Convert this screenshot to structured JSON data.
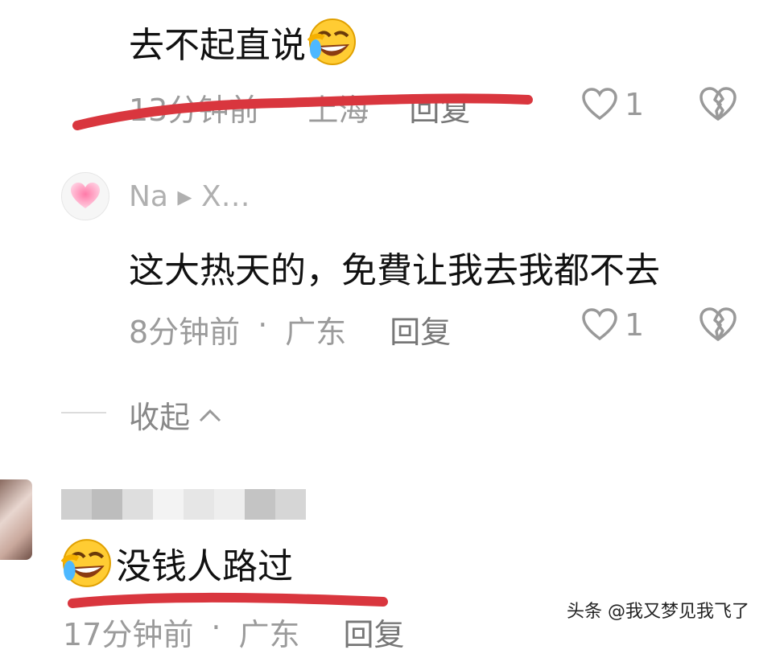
{
  "comments": [
    {
      "text": "去不起直说",
      "time": "13分钟前",
      "location": "上海",
      "reply_label": "回复",
      "likes": "1"
    },
    {
      "user": "Na ▸ X…",
      "text": "这大热天的，免費让我去我都不去",
      "time": "8分钟前",
      "separator": "·",
      "location": "广东",
      "reply_label": "回复",
      "likes": "1"
    },
    {
      "text": "没钱人路过",
      "time": "17分钟前",
      "separator": "·",
      "location": "广东",
      "reply_label": "回复"
    }
  ],
  "collapse": {
    "label": "收起"
  },
  "watermark": "头条 @我又梦见我飞了",
  "icons": {
    "like": "heart-outline-icon",
    "dislike": "broken-heart-icon",
    "laugh_emoji": "tears-of-joy-emoji-icon",
    "avatar": "pink-heart-avatar-icon"
  },
  "colors": {
    "red_underline": "#d9363e",
    "meta_gray": "#9b9b9b"
  }
}
